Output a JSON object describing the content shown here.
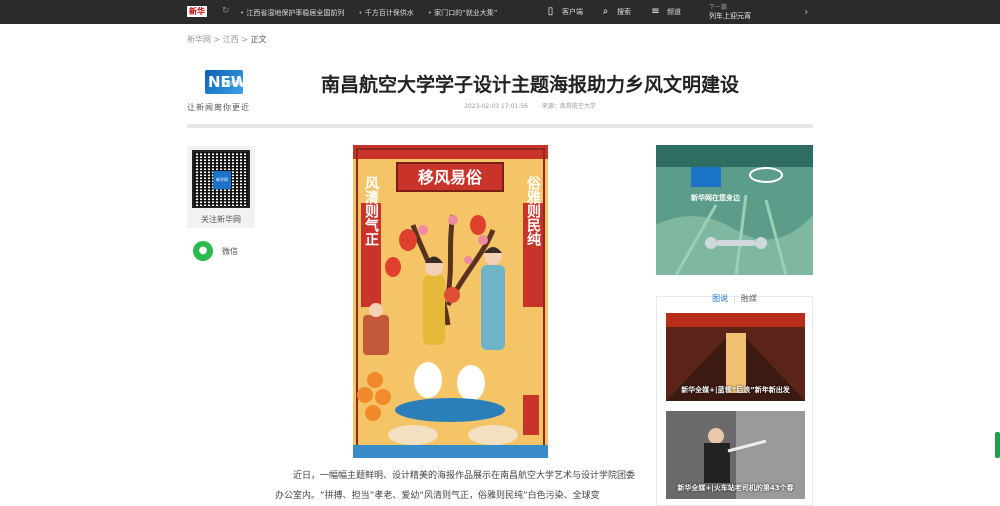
{
  "topbar": {
    "logo": "新华",
    "news": [
      "江西省湿地保护率稳居全国前列",
      "千方百计保供水",
      "家门口的“就业大集”"
    ],
    "client_label": "客户端",
    "search_label": "搜索",
    "channel_label": "频道",
    "next_label": "下一篇",
    "next_title": "列车上迎元宵"
  },
  "breadcrumb": {
    "home": "新华网",
    "sep": ">",
    "section": "江西",
    "current": "正文"
  },
  "brand": {
    "logo_text": "NEWS",
    "logo_sub": "新华网",
    "slogan": "让新闻离你更近"
  },
  "article": {
    "title": "南昌航空大学学子设计主题海报助力乡风文明建设",
    "date": "2023-02-03 17:01:56",
    "source": "来源：南昌航空大学",
    "poster": {
      "top": "移风易俗",
      "left": "风清则气正",
      "right": "俗雅则民纯"
    },
    "paragraph": "近日，一幅幅主题鲜明、设计精美的海报作品展示在南昌航空大学艺术与设计学院团委办公室内。“拼搏、担当”孝老、爱幼“风清则气正，俗雅则民纯”白色污染、全球变"
  },
  "sidebar": {
    "follow_label": "关注新华网",
    "qr_center": "新华网",
    "wechat_label": "微信"
  },
  "right": {
    "ad_caption": "新华网在您身边",
    "tabs": [
      "图说",
      "融媒"
    ],
    "cards": [
      {
        "caption": "新华全媒+|蓝领“后浪”新年新出发"
      },
      {
        "caption": "新华全媒+|火车站老司机的第43个春"
      }
    ]
  }
}
